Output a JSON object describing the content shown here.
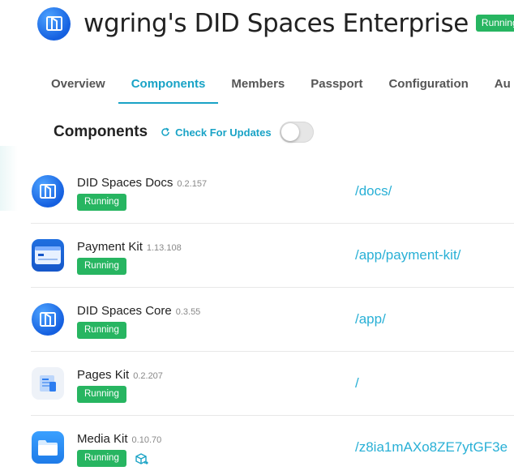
{
  "header": {
    "title": "wgring's DID Spaces Enterprise",
    "status": "Running",
    "logo_icon": "did-spaces-logo-icon"
  },
  "tabs": [
    {
      "label": "Overview",
      "active": false
    },
    {
      "label": "Components",
      "active": true
    },
    {
      "label": "Members",
      "active": false
    },
    {
      "label": "Passport",
      "active": false
    },
    {
      "label": "Configuration",
      "active": false
    },
    {
      "label": "Au",
      "active": false
    }
  ],
  "components_section": {
    "title": "Components",
    "check_updates_label": "Check For Updates",
    "toggle_on": false
  },
  "components": [
    {
      "name": "DID Spaces Docs",
      "version": "0.2.157",
      "status": "Running",
      "path": "/docs/",
      "icon": "did-spaces-icon"
    },
    {
      "name": "Payment Kit",
      "version": "1.13.108",
      "status": "Running",
      "path": "/app/payment-kit/",
      "icon": "payment-kit-icon"
    },
    {
      "name": "DID Spaces Core",
      "version": "0.3.55",
      "status": "Running",
      "path": "/app/",
      "icon": "did-spaces-icon"
    },
    {
      "name": "Pages Kit",
      "version": "0.2.207",
      "status": "Running",
      "path": "/",
      "icon": "pages-kit-icon"
    },
    {
      "name": "Media Kit",
      "version": "0.10.70",
      "status": "Running",
      "path": "/z8ia1mAXo8ZE7ytGF3e",
      "icon": "media-kit-icon",
      "extra_icon": "package-update-icon"
    }
  ],
  "colors": {
    "accent": "#19a3c6",
    "path_link": "#29b0d6",
    "running": "#27b561",
    "did_blue": "#1560e0"
  }
}
